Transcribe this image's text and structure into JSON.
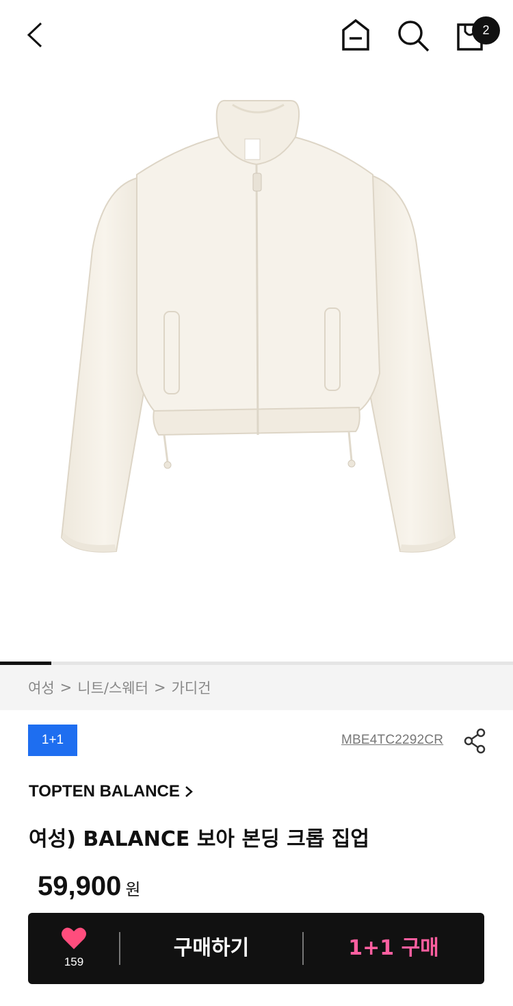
{
  "header": {
    "cart_count": "2",
    "icons": [
      "back-arrow-icon",
      "home-icon",
      "search-icon",
      "shopping-bag-icon"
    ]
  },
  "hero": {
    "image": "cream-fleece-zip-jacket",
    "progress": 0.1
  },
  "breadcrumb": {
    "items": [
      "여성",
      "니트/스웨터",
      "가디건"
    ],
    "separator": ">"
  },
  "product": {
    "tag": "1+1",
    "code": "MBE4TC2292CR",
    "brand": "TOPTEN BALANCE",
    "title": "여성) BALANCE 보아 본딩 크롭 집업",
    "price": "59,900",
    "price_unit": "원"
  },
  "buy_bar": {
    "wish_count": "159",
    "buy_label": "구매하기",
    "promo_label": "1+1 구매"
  },
  "colors": {
    "accent_blue": "#1e6ef0",
    "promo_pink": "#ff5fa0",
    "heart_pink": "#ff4d7d",
    "bar_black": "#111111"
  }
}
